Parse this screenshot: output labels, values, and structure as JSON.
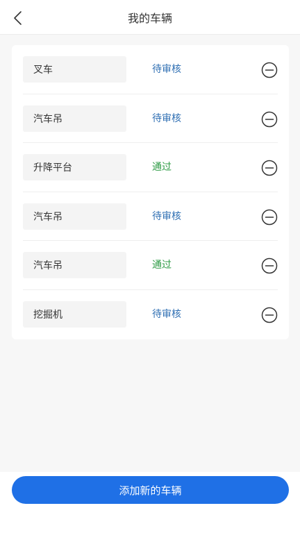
{
  "header": {
    "title": "我的车辆"
  },
  "vehicles": [
    {
      "name": "叉车",
      "status": "待审核"
    },
    {
      "name": "汽车吊",
      "status": "待审核"
    },
    {
      "name": "升降平台",
      "status": "通过"
    },
    {
      "name": "汽车吊",
      "status": "待审核"
    },
    {
      "name": "汽车吊",
      "status": "通过"
    },
    {
      "name": "挖掘机",
      "status": "待审核"
    }
  ],
  "footer": {
    "add_label": "添加新的车辆"
  },
  "colors": {
    "accent": "#1f70e6",
    "pending": "#2f6fb3",
    "passed": "#2e9b45"
  },
  "icons": {
    "back": "chevron-left-icon",
    "remove": "minus-circle-icon"
  }
}
